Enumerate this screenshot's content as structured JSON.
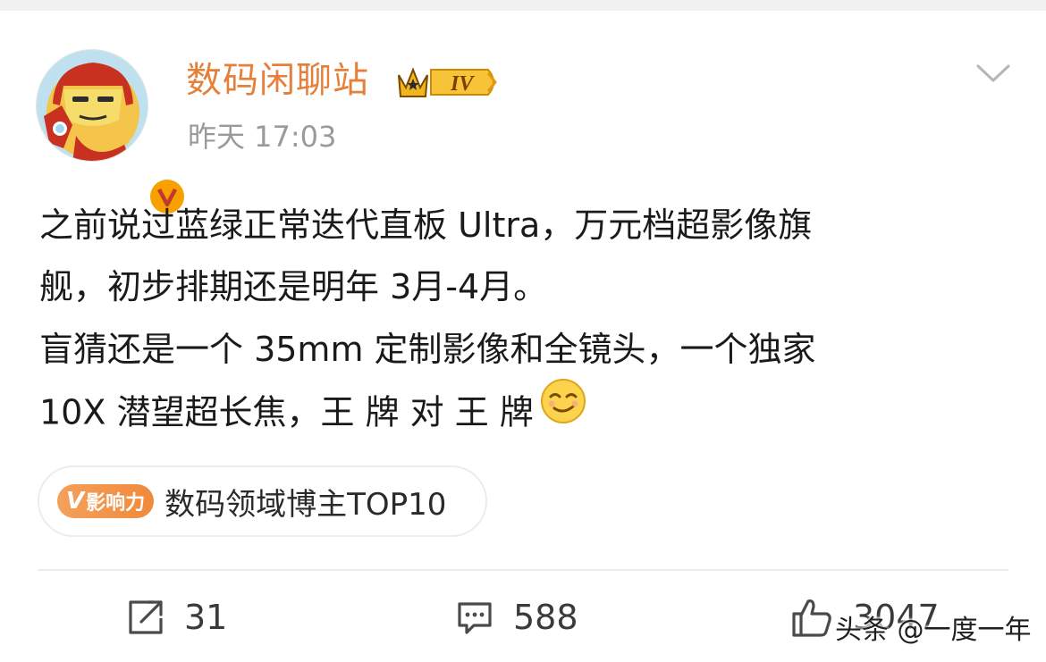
{
  "post": {
    "username": "数码闲聊站",
    "vip_level": "IV",
    "timestamp": "昨天 17:03",
    "body_lines": [
      "之前说过蓝绿正常迭代直板 Ultra，万元档超影像旗",
      "舰，初步排期还是明年 3月-4月。",
      "盲猜还是一个 35mm 定制影像和全镜头，一个独家",
      "10X 潜望超长焦，王 牌 对 王 牌"
    ],
    "influence": {
      "tag_letter": "V",
      "tag_text": "影响力",
      "label": "数码领域博主TOP10"
    }
  },
  "actions": {
    "repost_count": "31",
    "comment_count": "588",
    "like_count": "3047"
  },
  "watermark": "头条 @一度一年",
  "colors": {
    "username": "#e5803a",
    "timestamp": "#9a9a9a",
    "verified_badge": "#f7a000",
    "influence_tag": "#f08a3c",
    "text": "#1a1a1a"
  },
  "icons": {
    "menu": "chevron-down-icon",
    "vip": "crown-icon",
    "verified": "verified-v-icon",
    "repost": "share-icon",
    "comment": "comment-icon",
    "like": "thumbs-up-icon",
    "emoji": "smirk-emoji-icon"
  }
}
